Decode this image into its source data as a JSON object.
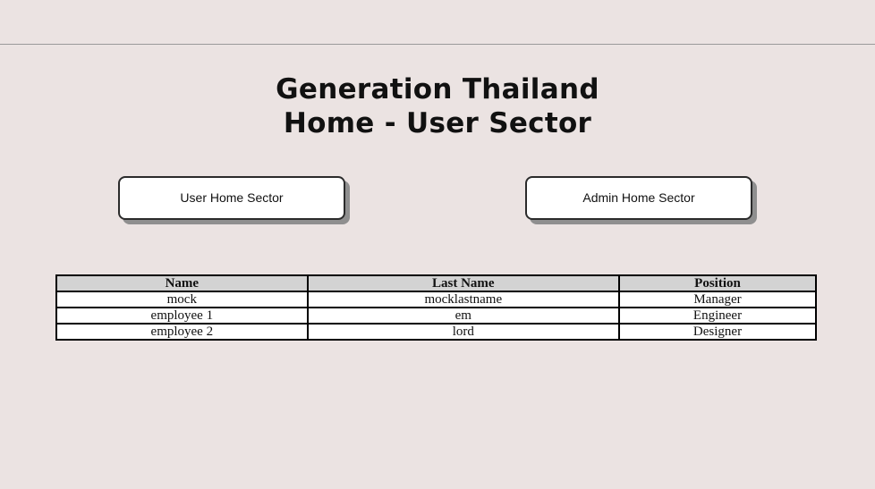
{
  "header": {
    "title_line1": "Generation Thailand",
    "title_line2": "Home - User Sector"
  },
  "nav": {
    "user_home_label": "User Home Sector",
    "admin_home_label": "Admin Home Sector"
  },
  "table": {
    "columns": [
      "Name",
      "Last Name",
      "Position"
    ],
    "rows": [
      [
        "mock",
        "mocklastname",
        "Manager"
      ],
      [
        "employee 1",
        "em",
        "Engineer"
      ],
      [
        "employee 2",
        "lord",
        "Designer"
      ]
    ]
  }
}
